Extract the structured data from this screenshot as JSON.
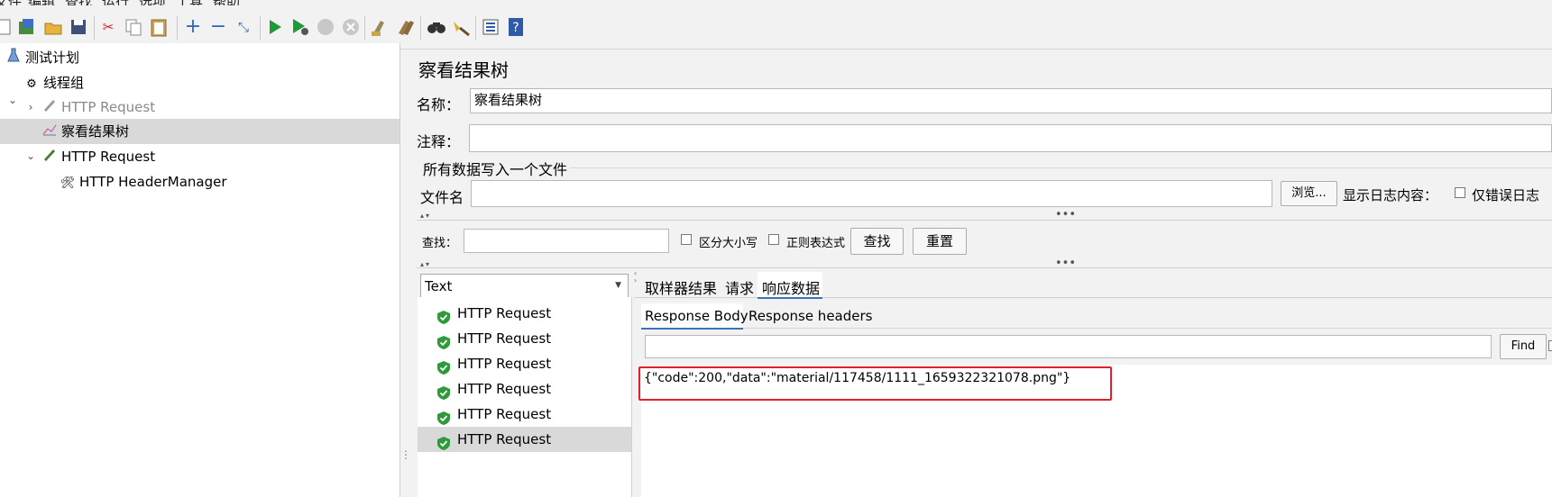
{
  "menubar": {
    "items": [
      "文件",
      "编辑",
      "查找",
      "运行",
      "选项",
      "工具",
      "帮助"
    ]
  },
  "toolbar": {
    "icons": [
      "new-icon",
      "templates-icon",
      "open-icon",
      "save-icon",
      "cut-icon",
      "copy-icon",
      "paste-icon",
      "expand-icon",
      "collapse-icon",
      "toggle-icon",
      "start-icon",
      "start-no-pause-icon",
      "stop-icon",
      "shutdown-icon",
      "clear-icon",
      "clear-all-icon",
      "search-icon",
      "reset-search-icon",
      "function-helper-icon",
      "help-icon"
    ]
  },
  "tree": {
    "items": [
      {
        "label": "测试计划",
        "icon": "flask-icon"
      },
      {
        "label": "线程组",
        "icon": "gear-icon"
      },
      {
        "label": "HTTP Request",
        "icon": "pen-icon",
        "disabled": true
      },
      {
        "label": "察看结果树",
        "icon": "graph-icon",
        "selected": true
      },
      {
        "label": "HTTP Request",
        "icon": "pen-icon"
      },
      {
        "label": "HTTP HeaderManager",
        "icon": "wrench-icon"
      }
    ]
  },
  "panel": {
    "title": "察看结果树",
    "name_label": "名称：",
    "name_value": "察看结果树",
    "comment_label": "注释：",
    "comment_value": "",
    "file_section": "所有数据写入一个文件",
    "filename_label": "文件名",
    "filename_value": "",
    "browse_label": "浏览...",
    "log_label": "显示日志内容：",
    "errors_only_label": "仅错误日志"
  },
  "search": {
    "label": "查找：",
    "value": "",
    "case_label": "区分大小写",
    "regex_label": "正则表达式",
    "find_label": "查找",
    "reset_label": "重置"
  },
  "renderer": {
    "selected": "Text"
  },
  "results": {
    "items": [
      "HTTP Request",
      "HTTP Request",
      "HTTP Request",
      "HTTP Request",
      "HTTP Request",
      "HTTP Request"
    ],
    "selected_index": 5
  },
  "tabs": {
    "items": [
      "取样器结果",
      "请求",
      "响应数据"
    ],
    "active": 2
  },
  "subtabs": {
    "items": [
      "Response Body",
      "Response headers"
    ],
    "active": 0
  },
  "response": {
    "find_value": "",
    "find_label": "Find",
    "body": "{\"code\":200,\"data\":\"material/117458/1111_1659322321078.png\"}"
  },
  "colors": {
    "selection": "#d9d9d9",
    "highlight_box": "#e0202a",
    "tab_underline": "#3b73b9",
    "success_shield": "#2e9a3a"
  }
}
